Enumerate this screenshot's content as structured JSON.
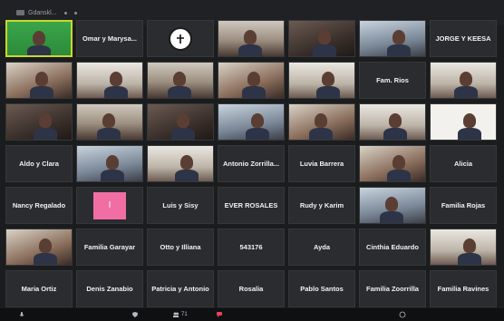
{
  "titlebar": {
    "title": "Gdanskl..."
  },
  "tiles": [
    {
      "name": "",
      "kind": "video",
      "scene": "green",
      "active": true
    },
    {
      "name": "Omar y Marysa...",
      "kind": "name"
    },
    {
      "name": "",
      "kind": "logo"
    },
    {
      "name": "",
      "kind": "video",
      "scene": "room"
    },
    {
      "name": "",
      "kind": "video",
      "scene": "dark"
    },
    {
      "name": "",
      "kind": "video",
      "scene": "blue"
    },
    {
      "name": "JORGE Y KEESA",
      "kind": "name"
    },
    {
      "name": "",
      "kind": "video",
      "scene": "warm"
    },
    {
      "name": "",
      "kind": "video",
      "scene": "light"
    },
    {
      "name": "",
      "kind": "video",
      "scene": "room"
    },
    {
      "name": "",
      "kind": "video",
      "scene": "warm"
    },
    {
      "name": "",
      "kind": "video",
      "scene": "light"
    },
    {
      "name": "Fam. Rios",
      "kind": "name"
    },
    {
      "name": "",
      "kind": "video",
      "scene": "light"
    },
    {
      "name": "",
      "kind": "video",
      "scene": "dark"
    },
    {
      "name": "",
      "kind": "video",
      "scene": "room"
    },
    {
      "name": "",
      "kind": "video",
      "scene": "dark"
    },
    {
      "name": "",
      "kind": "video",
      "scene": "blue"
    },
    {
      "name": "",
      "kind": "video",
      "scene": "warm"
    },
    {
      "name": "",
      "kind": "video",
      "scene": "light"
    },
    {
      "name": "",
      "kind": "video",
      "scene": "white"
    },
    {
      "name": "Aldo y Clara",
      "kind": "name"
    },
    {
      "name": "",
      "kind": "video",
      "scene": "blue"
    },
    {
      "name": "",
      "kind": "video",
      "scene": "light"
    },
    {
      "name": "Antonio Zorrilla...",
      "kind": "name"
    },
    {
      "name": "Luvia Barrera",
      "kind": "name"
    },
    {
      "name": "",
      "kind": "video",
      "scene": "warm"
    },
    {
      "name": "Alicia",
      "kind": "name"
    },
    {
      "name": "Nancy Regalado",
      "kind": "name"
    },
    {
      "name": "I",
      "kind": "pink"
    },
    {
      "name": "Luis y Sisy",
      "kind": "name"
    },
    {
      "name": "EVER ROSALES",
      "kind": "name"
    },
    {
      "name": "Rudy y Karim",
      "kind": "name"
    },
    {
      "name": "",
      "kind": "video",
      "scene": "blue"
    },
    {
      "name": "Familia Rojas",
      "kind": "name"
    },
    {
      "name": "",
      "kind": "video",
      "scene": "warm"
    },
    {
      "name": "Familia Garayar",
      "kind": "name"
    },
    {
      "name": "Otto y Illiana",
      "kind": "name"
    },
    {
      "name": "543176",
      "kind": "name"
    },
    {
      "name": "Ayda",
      "kind": "name"
    },
    {
      "name": "Cinthia Eduardo",
      "kind": "name"
    },
    {
      "name": "",
      "kind": "video",
      "scene": "light"
    },
    {
      "name": "Maria Ortiz",
      "kind": "name"
    },
    {
      "name": "Denis Zanabio",
      "kind": "name"
    },
    {
      "name": "Patricia y Antonio",
      "kind": "name"
    },
    {
      "name": "Rosalia",
      "kind": "name"
    },
    {
      "name": "Pablo Santos",
      "kind": "name"
    },
    {
      "name": "Familia Zoorrilla",
      "kind": "name"
    },
    {
      "name": "Familia Ravines",
      "kind": "name"
    }
  ],
  "toolbar": {
    "participants_count": "71"
  },
  "colors": {
    "active_border": "#c9d72e",
    "tile_bg": "#2a2c2f",
    "pink": "#f06ea3"
  }
}
